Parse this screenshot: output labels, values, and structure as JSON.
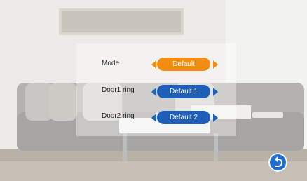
{
  "settings": {
    "rows": [
      {
        "label": "Mode",
        "value": "Default"
      },
      {
        "label": "Door1 ring",
        "value": "Default 1"
      },
      {
        "label": "Door2 ring",
        "value": "Default 2"
      }
    ]
  },
  "colors": {
    "orange": "#f28c12",
    "blue": "#1f5fb9",
    "back": "#1f6fd1"
  },
  "icons": {
    "left": "arrow-left-icon",
    "right": "arrow-right-icon",
    "back": "return-icon"
  }
}
